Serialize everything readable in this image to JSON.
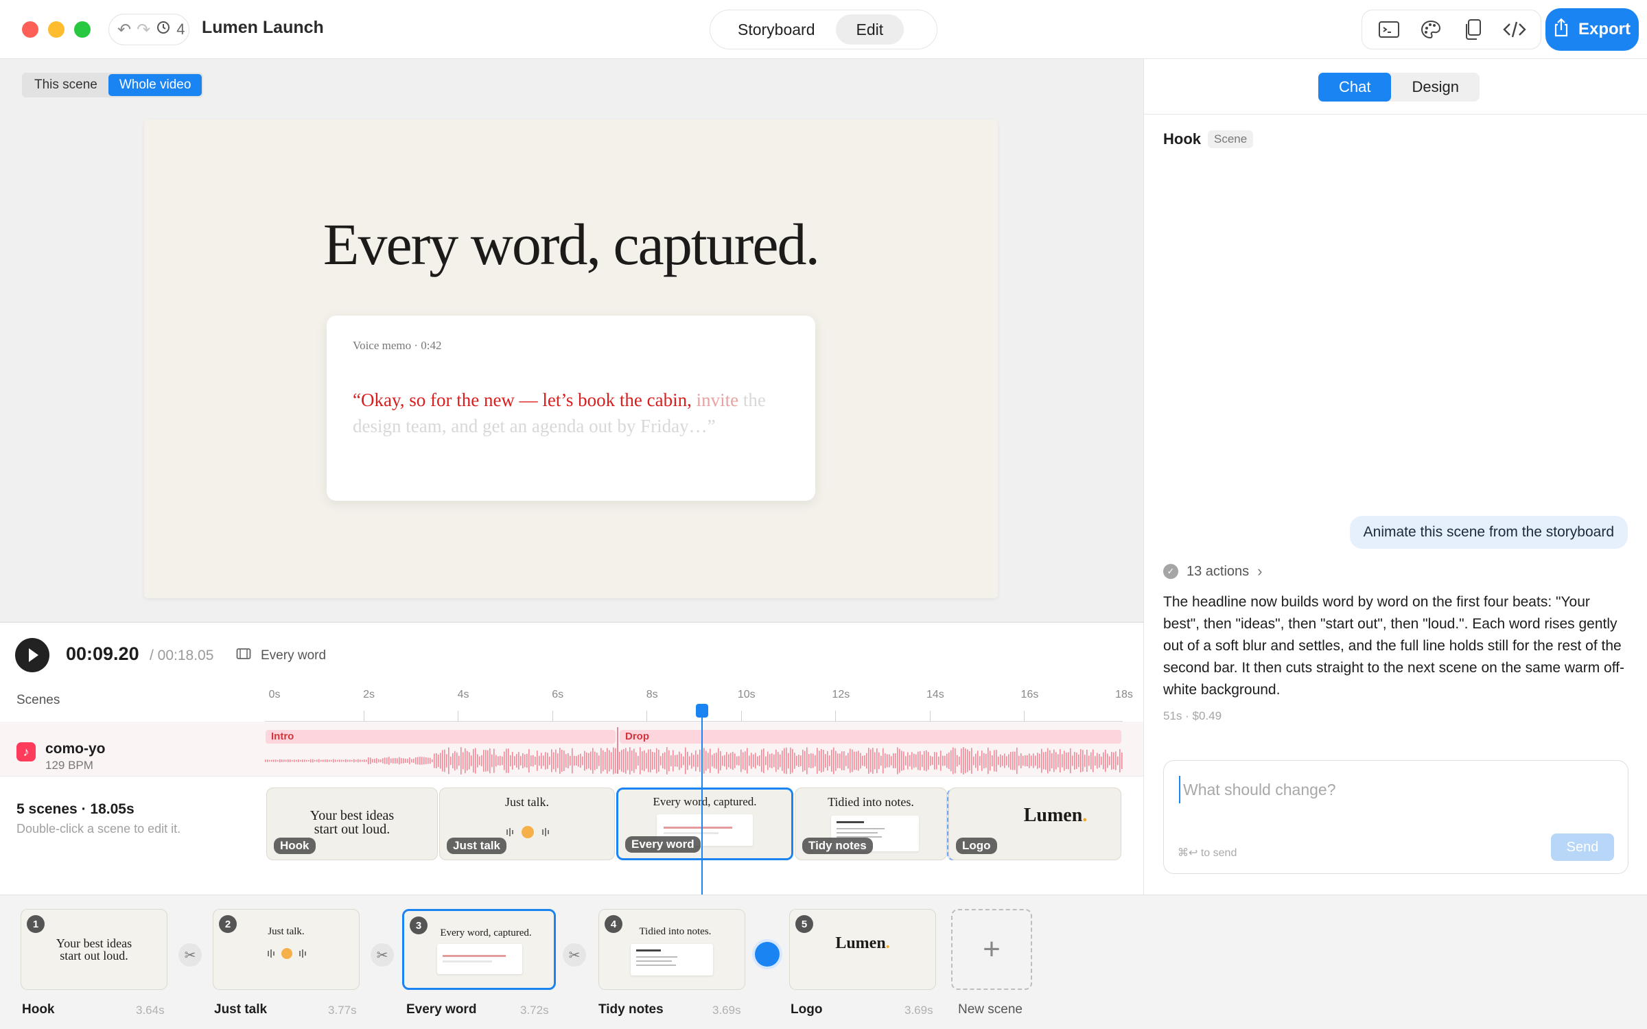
{
  "app": {
    "title": "Lumen Launch",
    "history_count": "4"
  },
  "mode_tabs": [
    "Storyboard",
    "Edit"
  ],
  "toolbar": {
    "export_label": "Export"
  },
  "preview": {
    "scope_tabs": [
      "This scene",
      "Whole video"
    ],
    "headline": "Every word, captured.",
    "memo_label": "Voice memo · 0:42",
    "quote_lit": "“Okay, so for the new — let’s book the cabin,",
    "quote_fade": "invite",
    "quote_dim": "the design team, and get an agenda out by Friday…”"
  },
  "playback": {
    "current_time": "00:09.20",
    "total_time": "/ 00:18.05",
    "scene_name": "Every word"
  },
  "timeline": {
    "scenes_label": "Scenes",
    "ticks": [
      "0s",
      "2s",
      "4s",
      "6s",
      "8s",
      "10s",
      "12s",
      "14s",
      "16s",
      "18s"
    ],
    "audio": {
      "name": "como-yo",
      "bpm": "129 BPM"
    },
    "sections": [
      "Intro",
      "Drop"
    ],
    "scene_summary": "5 scenes · 18.05s",
    "scene_hint": "Double-click a scene to edit it.",
    "clips": [
      {
        "tag": "Hook",
        "text": "Your best ideas start out loud."
      },
      {
        "tag": "Just talk",
        "text": "Just talk."
      },
      {
        "tag": "Every word",
        "text": "Every word, captured."
      },
      {
        "tag": "Tidy notes",
        "text": "Tidied into notes."
      },
      {
        "tag": "Logo",
        "text": "Lumen"
      }
    ]
  },
  "storyboard": {
    "scenes": [
      {
        "num": "1",
        "name": "Hook",
        "duration": "3.64s",
        "text": "Your best ideas start out loud."
      },
      {
        "num": "2",
        "name": "Just talk",
        "duration": "3.77s",
        "text": "Just talk."
      },
      {
        "num": "3",
        "name": "Every word",
        "duration": "3.72s",
        "text": "Every word, captured."
      },
      {
        "num": "4",
        "name": "Tidy notes",
        "duration": "3.69s",
        "text": "Tidied into notes."
      },
      {
        "num": "5",
        "name": "Logo",
        "duration": "3.69s",
        "text": "Lumen"
      }
    ],
    "new_scene_label": "New scene"
  },
  "panel": {
    "tabs": [
      "Chat",
      "Design"
    ],
    "scene_title": "Hook",
    "scene_chip": "Scene",
    "user_message": "Animate this scene from the storyboard",
    "actions": "13 actions",
    "assistant_message": "The headline now builds word by word on the first four beats: \"Your best\", then \"ideas\", then \"start out\", then \"loud.\". Each word rises gently out of a soft blur and settles, and the full line holds still for the rest of the second bar. It then cuts straight to the next scene on the same warm off-white background.",
    "meta": "51s · $0.49",
    "composer_placeholder": "What should change?",
    "composer_hint": "⌘↩ to send",
    "send_label": "Send"
  },
  "colors": {
    "accent": "#1a84f2",
    "audio_band": "#fcd6dc",
    "waveform": "#f08a99",
    "quote_red": "#d81e1e"
  }
}
